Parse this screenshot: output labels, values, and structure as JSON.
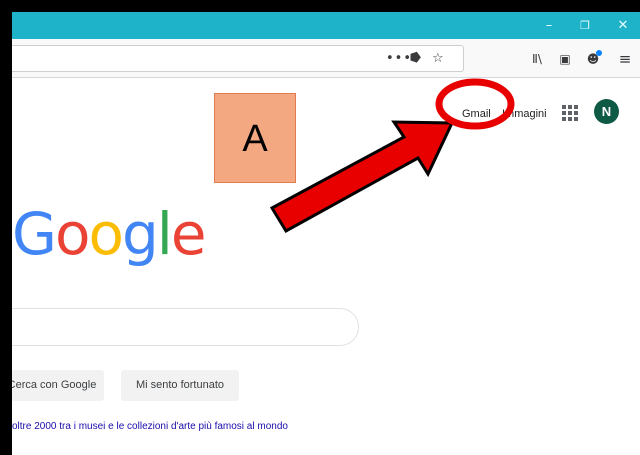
{
  "browser": {
    "window_controls": {
      "minimize": "–",
      "restore": "❐",
      "close": "✕"
    },
    "url_actions": {
      "more": "•••",
      "pocket": "⭓",
      "bookmark": "☆"
    },
    "toolbar": {
      "library": "Ⅱ\\",
      "sidebar": "▣",
      "account": "☻",
      "menu": "≡"
    }
  },
  "google": {
    "header": {
      "gmail": "Gmail",
      "images": "Immagini",
      "avatar_initial": "N"
    },
    "logo": {
      "letters": [
        "G",
        "o",
        "o",
        "g",
        "l",
        "e"
      ]
    },
    "buttons": {
      "search": "Cerca con Google",
      "lucky": "Mi sento fortunato"
    },
    "promo_text": "oltre 2000 tra i musei e le collezioni d'arte più famosi al mondo"
  },
  "annotation": {
    "label": "A",
    "colors": {
      "label_fill": "#f4a882",
      "arrow": "#e80000",
      "circle": "#e80000"
    }
  },
  "colors": {
    "titlebar": "#1fb3c9",
    "avatar": "#0f5a45",
    "link": "#1a0dab"
  }
}
